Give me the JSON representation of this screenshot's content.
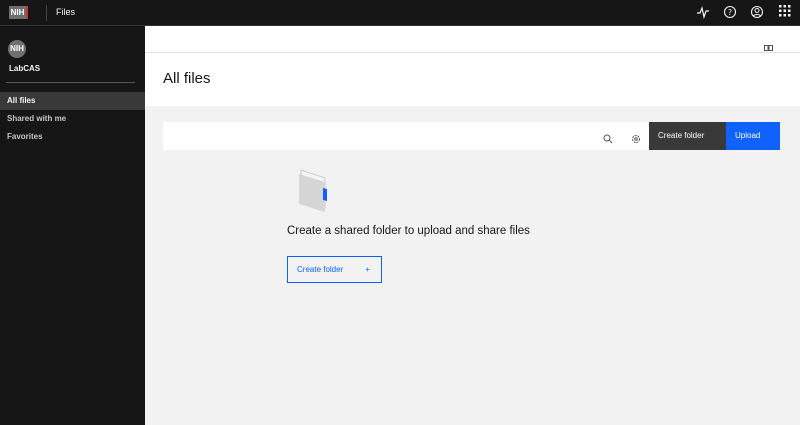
{
  "topbar": {
    "logo": "NIH",
    "title": "Files",
    "icons": [
      "activity-icon",
      "help-icon",
      "user-icon",
      "app-switcher-icon"
    ]
  },
  "sidebar": {
    "avatar": "NIH",
    "org": "LabCAS",
    "items": [
      {
        "label": "All files",
        "active": true
      },
      {
        "label": "Shared with me"
      },
      {
        "label": "Favorites"
      }
    ]
  },
  "main": {
    "title": "All files",
    "search_placeholder": "",
    "create_folder": "Create folder",
    "upload": "Upload",
    "empty": {
      "message": "Create a shared folder to upload and share files",
      "button": "Create folder",
      "button_icon": "+"
    }
  },
  "colors": {
    "accent": "#0f62fe",
    "sidebar": "#161616"
  }
}
